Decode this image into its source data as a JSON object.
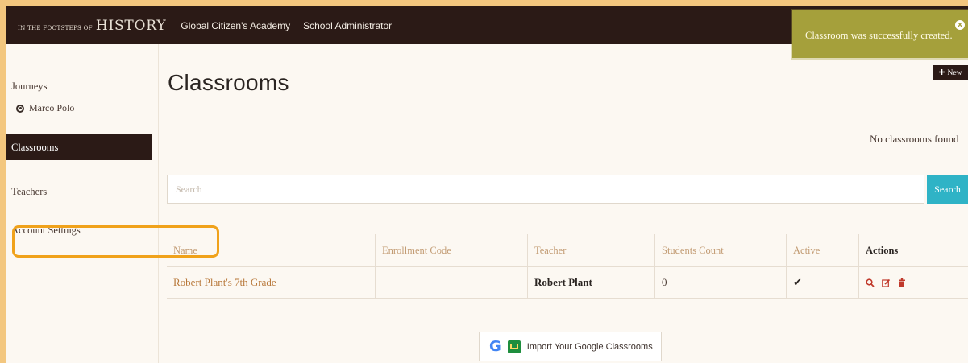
{
  "brand": {
    "small": "In The Footsteps Of",
    "big": "HISTORY"
  },
  "topnav": {
    "academy": "Global Citizen's Academy",
    "role": "School Administrator"
  },
  "sidebar": {
    "journeys": "Journeys",
    "marco_polo": "Marco Polo",
    "classrooms": "Classrooms",
    "teachers": "Teachers",
    "account_settings": "Account Settings"
  },
  "main": {
    "title": "Classrooms",
    "new_label": "New",
    "empty_message": "No classrooms found",
    "search": {
      "placeholder": "Search",
      "button": "Search"
    },
    "table": {
      "headers": [
        "Name",
        "Enrollment Code",
        "Teacher",
        "Students Count",
        "Active",
        "Actions"
      ],
      "rows": [
        {
          "name": "Robert Plant's 7th Grade",
          "enrollment_code": "",
          "teacher": "Robert Plant",
          "students_count": "0",
          "active": "✔"
        }
      ]
    },
    "google_import": "Import Your Google Classrooms"
  },
  "toast": {
    "message": "Classroom was successfully created.",
    "close": "x"
  },
  "colors": {
    "topbar": "#2b1a16",
    "accent": "#2fb3c6",
    "toast": "#a5a03b",
    "highlight": "#f0a21b",
    "link": "#b8783a"
  },
  "icons": [
    "compass-icon",
    "plus-icon",
    "search-icon",
    "edit-icon",
    "trash-icon",
    "checkmark-icon",
    "google-icon",
    "google-classroom-icon",
    "close-icon"
  ]
}
